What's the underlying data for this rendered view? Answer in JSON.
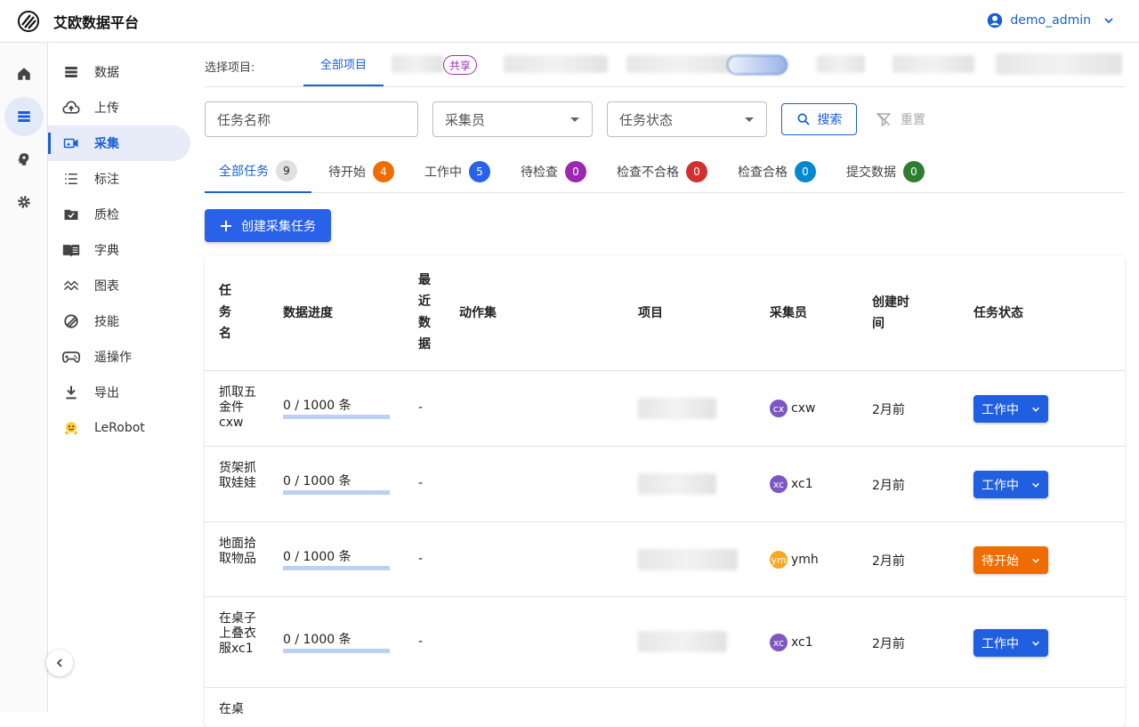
{
  "app": {
    "title": "艾欧数据平台"
  },
  "user": {
    "name": "demo_admin"
  },
  "sidebar": {
    "items": [
      {
        "label": "数据",
        "icon": "storage-icon"
      },
      {
        "label": "上传",
        "icon": "cloud-upload-icon"
      },
      {
        "label": "采集",
        "icon": "video-camera-icon"
      },
      {
        "label": "标注",
        "icon": "list-icon"
      },
      {
        "label": "质检",
        "icon": "folder-check-icon"
      },
      {
        "label": "字典",
        "icon": "book-icon"
      },
      {
        "label": "图表",
        "icon": "chart-wave-icon"
      },
      {
        "label": "技能",
        "icon": "skill-ring-icon"
      },
      {
        "label": "遥操作",
        "icon": "gamepad-icon"
      },
      {
        "label": "导出",
        "icon": "download-icon"
      },
      {
        "label": "LeRobot",
        "icon": "hugging-face-icon"
      }
    ]
  },
  "projects": {
    "label": "选择项目:",
    "all": "全部项目",
    "share_badge": "共享"
  },
  "filters": {
    "task_name_placeholder": "任务名称",
    "collector_placeholder": "采集员",
    "status_placeholder": "任务状态",
    "search": "搜索",
    "reset": "重置"
  },
  "tabs": [
    {
      "label": "全部任务",
      "count": "9",
      "color": "#e0e0e0"
    },
    {
      "label": "待开始",
      "count": "4",
      "color": "#ef6c00"
    },
    {
      "label": "工作中",
      "count": "5",
      "color": "#2962e8"
    },
    {
      "label": "待检查",
      "count": "0",
      "color": "#9c27b0"
    },
    {
      "label": "检查不合格",
      "count": "0",
      "color": "#d32f2f"
    },
    {
      "label": "检查合格",
      "count": "0",
      "color": "#0288d1"
    },
    {
      "label": "提交数据",
      "count": "0",
      "color": "#2e7d32"
    }
  ],
  "create_button": "创建采集任务",
  "table": {
    "headers": {
      "name": "任务名",
      "progress": "数据进度",
      "recent": "最近数据",
      "actions": "动作集",
      "project": "项目",
      "collector": "采集员",
      "created": "创建时间",
      "status": "任务状态"
    },
    "rows": [
      {
        "name": "抓取五金件cxw",
        "progress": "0 / 1000 条",
        "recent": "-",
        "avatar": "cx",
        "avatar_color": "#7e57c2",
        "collector": "cxw",
        "created": "2月前",
        "status": "工作中",
        "status_color": "#1f5fe0"
      },
      {
        "name": "货架抓取娃娃",
        "progress": "0 / 1000 条",
        "recent": "-",
        "avatar": "xc",
        "avatar_color": "#7e57c2",
        "collector": "xc1",
        "created": "2月前",
        "status": "工作中",
        "status_color": "#1f5fe0"
      },
      {
        "name": "地面拾取物品",
        "progress": "0 / 1000 条",
        "recent": "-",
        "avatar": "ym",
        "avatar_color": "#f9a825",
        "collector": "ymh",
        "created": "2月前",
        "status": "待开始",
        "status_color": "#ef6c00"
      },
      {
        "name": "在桌子上叠衣服xc1",
        "progress": "0 / 1000 条",
        "recent": "-",
        "avatar": "xc",
        "avatar_color": "#7e57c2",
        "collector": "xc1",
        "created": "2月前",
        "status": "工作中",
        "status_color": "#1f5fe0"
      },
      {
        "name": "在桌"
      }
    ]
  }
}
